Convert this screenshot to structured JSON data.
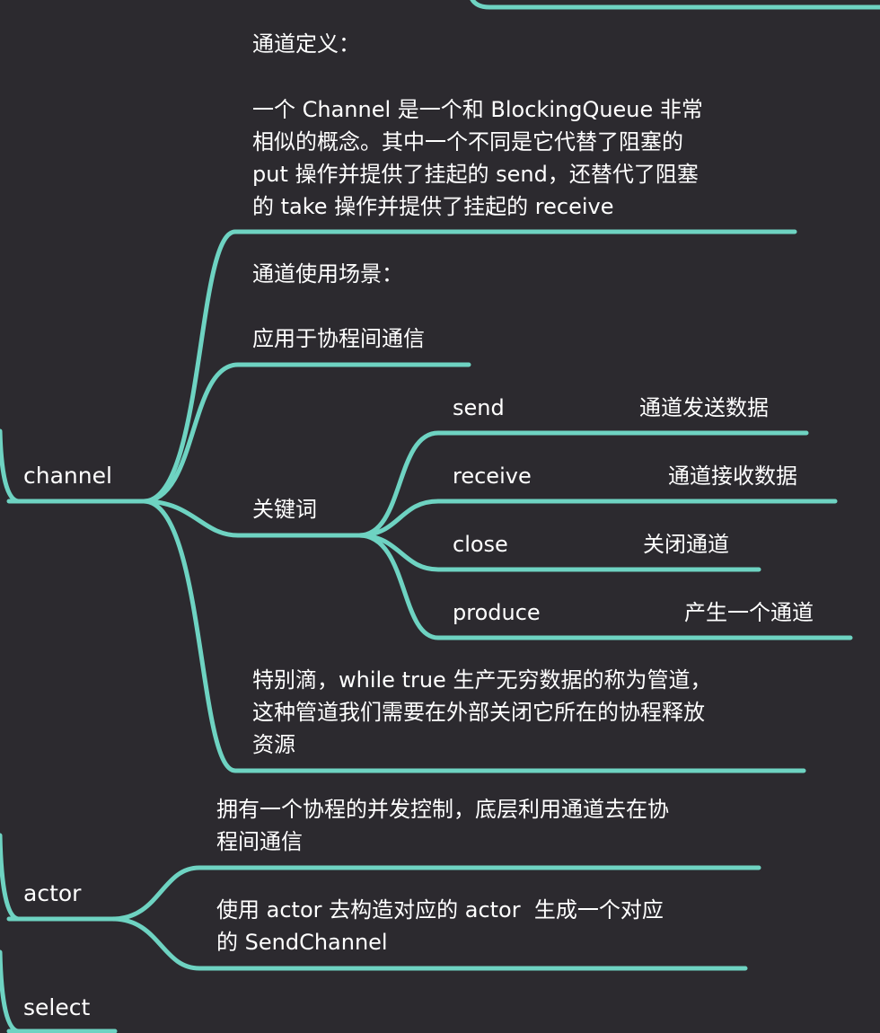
{
  "colors": {
    "background": "#2c2a2f",
    "branch": "#6ed3c2",
    "text": "#ffffff"
  },
  "nodes": {
    "channel": {
      "label": "channel",
      "definition": {
        "line1": "通道定义：",
        "line2": "一个 Channel 是一个和 BlockingQueue 非常",
        "line3": "相似的概念。其中一个不同是它代替了阻塞的",
        "line4": "put 操作并提供了挂起的 send，还替代了阻塞",
        "line5": "的 take 操作并提供了挂起的 receive"
      },
      "usage": {
        "line1": "通道使用场景：",
        "line2": "应用于协程间通信"
      },
      "keywords": {
        "label": "关键词",
        "items": [
          {
            "name": "send",
            "desc": "通道发送数据"
          },
          {
            "name": "receive",
            "desc": "通道接收数据"
          },
          {
            "name": "close",
            "desc": "关闭通道"
          },
          {
            "name": "produce",
            "desc": "产生一个通道"
          }
        ]
      },
      "note": {
        "line1": "特别滴，while true 生产无穷数据的称为管道，",
        "line2": "这种管道我们需要在外部关闭它所在的协程释放",
        "line3": "资源"
      }
    },
    "actor": {
      "label": "actor",
      "item1": {
        "line1": "拥有一个协程的并发控制，底层利用通道去在协",
        "line2": "程间通信"
      },
      "item2": {
        "line1": "使用 actor 去构造对应的 actor  生成一个对应",
        "line2": "的 SendChannel"
      }
    },
    "select": {
      "label": "select"
    }
  }
}
